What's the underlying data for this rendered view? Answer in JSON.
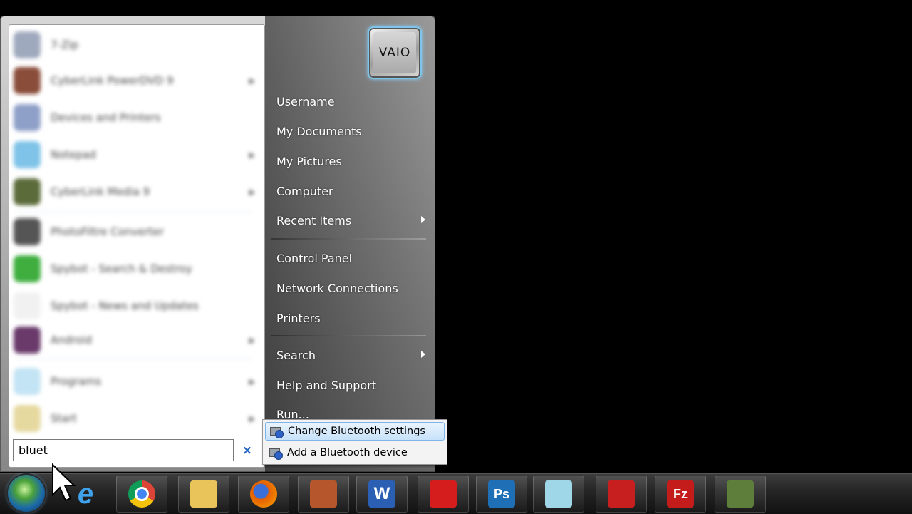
{
  "start_menu": {
    "programs": [
      {
        "label": "7-Zip",
        "has_submenu": false,
        "color": "#9fa9bd"
      },
      {
        "label": "CyberLink PowerDVD 9",
        "has_submenu": true,
        "color": "#8a4d3a"
      },
      {
        "label": "Devices and Printers",
        "has_submenu": false,
        "color": "#8fa0c8"
      },
      {
        "label": "Notepad",
        "has_submenu": true,
        "color": "#7fc3e8"
      },
      {
        "label": "CyberLink Media 9",
        "has_submenu": true,
        "color": "#5b6b3a"
      },
      {
        "label": "PhotoFiltre Converter",
        "has_submenu": false,
        "color": "#555555"
      },
      {
        "label": "Spybot - Search & Destroy",
        "has_submenu": false,
        "color": "#3fae3f"
      },
      {
        "label": "Spybot - News and Updates",
        "has_submenu": false,
        "color": "#f1f1f1"
      },
      {
        "label": "Android",
        "has_submenu": true,
        "color": "#6a3a6a"
      },
      {
        "label": "Programs",
        "has_submenu": true,
        "color": "#c3e4f4"
      },
      {
        "label": "Start",
        "has_submenu": true,
        "color": "#e6d9a0"
      }
    ],
    "search": {
      "value": "bluet",
      "clear_label": "×"
    },
    "user_tile": {
      "label": "VAIO"
    },
    "right_links": {
      "username": "Username",
      "my_documents": "My Documents",
      "my_pictures": "My Pictures",
      "computer": "Computer",
      "recent_items": "Recent Items",
      "control_panel": "Control Panel",
      "network_connections": "Network Connections",
      "printers": "Printers",
      "search": "Search",
      "help_and_support": "Help and Support",
      "run": "Run..."
    }
  },
  "flyout": {
    "items": [
      {
        "label": "Change Bluetooth settings",
        "highlighted": true
      },
      {
        "label": "Add a Bluetooth device",
        "highlighted": false
      }
    ]
  },
  "taskbar": {
    "start_button": "start-orb",
    "pinned": [
      {
        "name": "internet-explorer-icon",
        "glyph": "e",
        "color": "#2a8ad6"
      },
      {
        "name": "chrome-icon",
        "glyph": "",
        "color": "#db4437"
      },
      {
        "name": "file-explorer-icon",
        "glyph": "",
        "color": "#e8c45b"
      },
      {
        "name": "firefox-icon",
        "glyph": "",
        "color": "#e66000"
      },
      {
        "name": "firewall-icon",
        "glyph": "",
        "color": "#b5562c"
      },
      {
        "name": "word-icon",
        "glyph": "W",
        "color": "#2b5fb4"
      },
      {
        "name": "acrobat-icon",
        "glyph": "",
        "color": "#d61d1d"
      },
      {
        "name": "photoshop-icon",
        "glyph": "Ps",
        "color": "#1e6fb5"
      },
      {
        "name": "glass-window-icon",
        "glyph": "",
        "color": "#9fd6e8"
      },
      {
        "name": "downloader-icon",
        "glyph": "",
        "color": "#c71f1f"
      },
      {
        "name": "filezilla-icon",
        "glyph": "Fz",
        "color": "#c41b1b"
      },
      {
        "name": "install-icon",
        "glyph": "",
        "color": "#5e7f3c"
      }
    ]
  }
}
